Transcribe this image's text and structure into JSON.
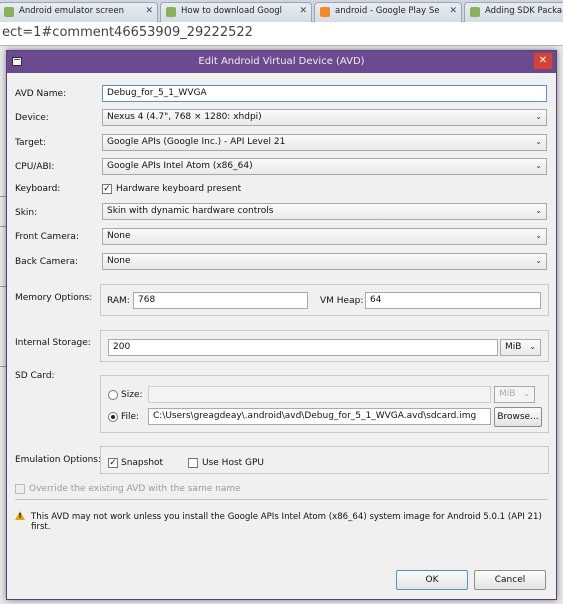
{
  "browser": {
    "tabs": [
      {
        "title": "Android emulator screen",
        "color": "#8ab15a"
      },
      {
        "title": "How to download Googl",
        "color": "#8ab15a"
      },
      {
        "title": "android - Google Play Se",
        "color": "#f08a24"
      },
      {
        "title": "Adding SDK Packa",
        "color": "#8ab15a"
      }
    ],
    "url": "ect=1#comment46653909_29222522"
  },
  "dialog": {
    "title": "Edit Android Virtual Device (AVD)",
    "close_label": "✕",
    "avd_name_label": "AVD Name:",
    "avd_name_value": "Debug_for_5_1_WVGA",
    "device_label": "Device:",
    "device_value": "Nexus 4 (4.7\", 768 × 1280: xhdpi)",
    "target_label": "Target:",
    "target_value": "Google APIs (Google Inc.) - API Level 21",
    "cpu_label": "CPU/ABI:",
    "cpu_value": "Google APIs Intel Atom (x86_64)",
    "keyboard_label": "Keyboard:",
    "keyboard_checkbox_label": "Hardware keyboard present",
    "keyboard_checked": true,
    "skin_label": "Skin:",
    "skin_value": "Skin with dynamic hardware controls",
    "front_camera_label": "Front Camera:",
    "front_camera_value": "None",
    "back_camera_label": "Back Camera:",
    "back_camera_value": "None",
    "memory_label": "Memory Options:",
    "ram_label": "RAM:",
    "ram_value": "768",
    "vmheap_label": "VM Heap:",
    "vmheap_value": "64",
    "internal_storage_label": "Internal Storage:",
    "internal_storage_value": "200",
    "internal_storage_unit": "MiB",
    "sdcard_label": "SD Card:",
    "size_label": "Size:",
    "size_value": "",
    "size_unit": "MiB",
    "file_label": "File:",
    "file_value": "C:\\Users\\greagdeay\\.android\\avd\\Debug_for_5_1_WVGA.avd\\sdcard.img",
    "browse_label": "Browse...",
    "emulation_label": "Emulation Options:",
    "snapshot_label": "Snapshot",
    "snapshot_checked": true,
    "host_gpu_label": "Use Host GPU",
    "host_gpu_checked": false,
    "override_label": "Override the existing AVD with the same name",
    "warning_text": "This AVD may not work unless you install the Google APIs Intel Atom (x86_64) system image for Android 5.0.1 (API 21) first.",
    "ok_label": "OK",
    "cancel_label": "Cancel",
    "accent_color": "#6a4b8f"
  }
}
